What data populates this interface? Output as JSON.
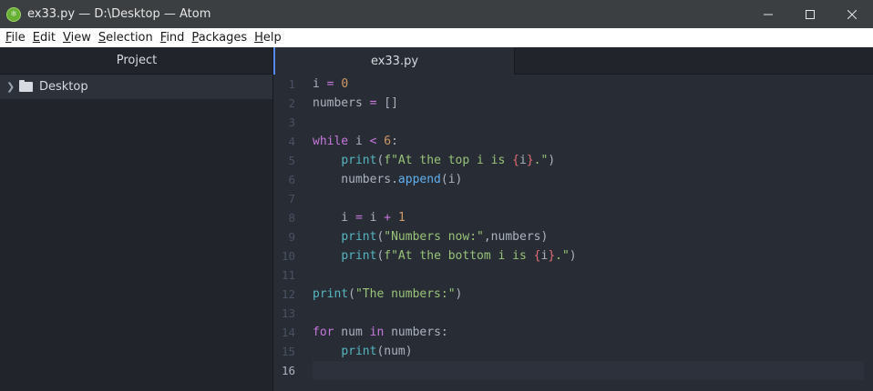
{
  "window": {
    "title": "ex33.py — D:\\Desktop — Atom",
    "app_icon": "atom-icon",
    "controls": [
      "minimize",
      "maximize",
      "close"
    ]
  },
  "menu": [
    {
      "label": "File",
      "mnemonic": "F",
      "rest": "ile"
    },
    {
      "label": "Edit",
      "mnemonic": "E",
      "rest": "dit"
    },
    {
      "label": "View",
      "mnemonic": "V",
      "rest": "iew"
    },
    {
      "label": "Selection",
      "mnemonic": "S",
      "rest": "election"
    },
    {
      "label": "Find",
      "mnemonic": "F",
      "rest": "ind",
      "underline_last": false
    },
    {
      "label": "Packages",
      "mnemonic": "P",
      "rest": "ackages"
    },
    {
      "label": "Help",
      "mnemonic": "H",
      "rest": "elp"
    }
  ],
  "tree": {
    "header": "Project",
    "root_folder": "Desktop"
  },
  "tabs": [
    {
      "label": "ex33.py",
      "active": true
    }
  ],
  "editor": {
    "cursor_line": 16,
    "lines": [
      {
        "n": "1",
        "tokens": [
          [
            "id",
            "i"
          ],
          [
            "op",
            " = "
          ],
          [
            "num",
            "0"
          ]
        ]
      },
      {
        "n": "2",
        "tokens": [
          [
            "id",
            "numbers "
          ],
          [
            "op",
            "="
          ],
          [
            "id",
            " []"
          ]
        ]
      },
      {
        "n": "3",
        "tokens": []
      },
      {
        "n": "4",
        "tokens": [
          [
            "kw",
            "while"
          ],
          [
            "id",
            " i "
          ],
          [
            "op",
            "<"
          ],
          [
            "id",
            " "
          ],
          [
            "num",
            "6"
          ],
          [
            "id",
            ":"
          ]
        ]
      },
      {
        "n": "5",
        "tokens": [
          [
            "id",
            "    "
          ],
          [
            "fn",
            "print"
          ],
          [
            "id",
            "("
          ],
          [
            "str",
            "f\"At the top i is "
          ],
          [
            "brace",
            "{"
          ],
          [
            "id",
            "i"
          ],
          [
            "brace",
            "}"
          ],
          [
            "str",
            ".\""
          ],
          [
            "id",
            ")"
          ]
        ]
      },
      {
        "n": "6",
        "tokens": [
          [
            "id",
            "    numbers."
          ],
          [
            "meth",
            "append"
          ],
          [
            "id",
            "(i)"
          ]
        ]
      },
      {
        "n": "7",
        "tokens": []
      },
      {
        "n": "8",
        "tokens": [
          [
            "id",
            "    i "
          ],
          [
            "op",
            "="
          ],
          [
            "id",
            " i "
          ],
          [
            "op",
            "+"
          ],
          [
            "id",
            " "
          ],
          [
            "num",
            "1"
          ]
        ]
      },
      {
        "n": "9",
        "tokens": [
          [
            "id",
            "    "
          ],
          [
            "fn",
            "print"
          ],
          [
            "id",
            "("
          ],
          [
            "str",
            "\"Numbers now:\""
          ],
          [
            "id",
            ",numbers)"
          ]
        ]
      },
      {
        "n": "10",
        "tokens": [
          [
            "id",
            "    "
          ],
          [
            "fn",
            "print"
          ],
          [
            "id",
            "("
          ],
          [
            "str",
            "f\"At the bottom i is "
          ],
          [
            "brace",
            "{"
          ],
          [
            "id",
            "i"
          ],
          [
            "brace",
            "}"
          ],
          [
            "str",
            ".\""
          ],
          [
            "id",
            ")"
          ]
        ]
      },
      {
        "n": "11",
        "tokens": []
      },
      {
        "n": "12",
        "tokens": [
          [
            "fn",
            "print"
          ],
          [
            "id",
            "("
          ],
          [
            "str",
            "\"The numbers:\""
          ],
          [
            "id",
            ")"
          ]
        ]
      },
      {
        "n": "13",
        "tokens": []
      },
      {
        "n": "14",
        "tokens": [
          [
            "kw",
            "for"
          ],
          [
            "id",
            " num "
          ],
          [
            "kw",
            "in"
          ],
          [
            "id",
            " numbers:"
          ]
        ]
      },
      {
        "n": "15",
        "tokens": [
          [
            "id",
            "    "
          ],
          [
            "fn",
            "print"
          ],
          [
            "id",
            "(num)"
          ]
        ]
      },
      {
        "n": "16",
        "tokens": []
      }
    ]
  },
  "colors": {
    "accent": "#568af2",
    "keyword": "#c678dd",
    "number": "#d19a66",
    "string": "#98c379",
    "builtin": "#56b6c2",
    "method": "#61afef",
    "interpolation_brace": "#e06c75"
  }
}
